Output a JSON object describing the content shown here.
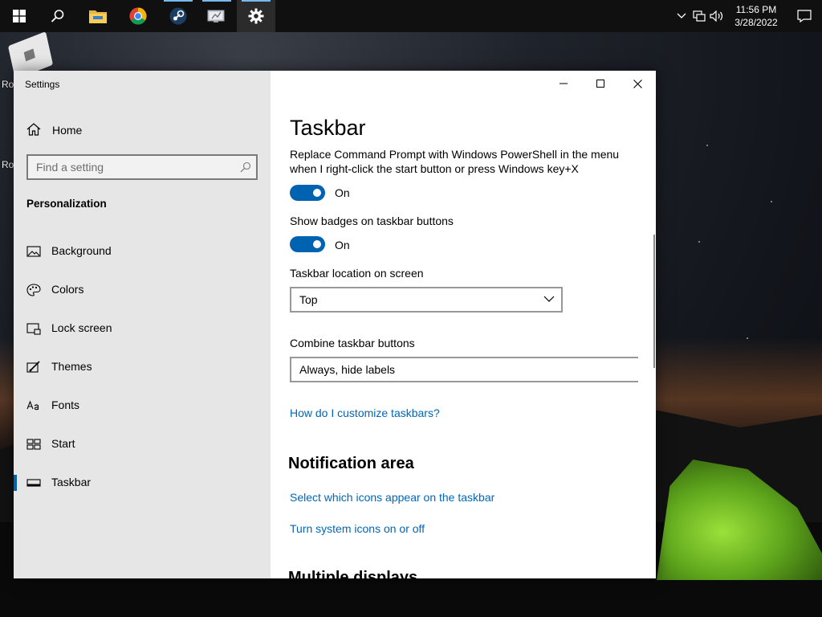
{
  "desktop": {
    "icon_label_1": "Ro",
    "icon_label_2": "Ro"
  },
  "taskbar": {
    "apps": [
      {
        "icon": "windows-start-icon"
      },
      {
        "icon": "search-icon"
      },
      {
        "icon": "file-explorer-icon"
      },
      {
        "icon": "chrome-icon"
      },
      {
        "icon": "steam-icon",
        "running": true
      },
      {
        "icon": "remote-desktop-icon",
        "running": true
      },
      {
        "icon": "settings-gear-icon",
        "running": true,
        "active": true
      }
    ],
    "clock": {
      "time": "11:56 PM",
      "date": "3/28/2022"
    }
  },
  "window": {
    "title": "Settings",
    "nav": {
      "home_label": "Home",
      "search_placeholder": "Find a setting",
      "section_title": "Personalization",
      "items": [
        {
          "label": "Background",
          "icon": "picture-icon"
        },
        {
          "label": "Colors",
          "icon": "palette-icon"
        },
        {
          "label": "Lock screen",
          "icon": "lock-screen-icon"
        },
        {
          "label": "Themes",
          "icon": "themes-brush-icon"
        },
        {
          "label": "Fonts",
          "icon": "fonts-icon"
        },
        {
          "label": "Start",
          "icon": "start-tiles-icon"
        },
        {
          "label": "Taskbar",
          "icon": "taskbar-icon",
          "selected": true
        }
      ]
    },
    "content": {
      "page_title": "Taskbar",
      "powershell_label": "Replace Command Prompt with Windows PowerShell in the menu when I right-click the start button or press Windows key+X",
      "powershell_state": "On",
      "badges_label": "Show badges on taskbar buttons",
      "badges_state": "On",
      "location_label": "Taskbar location on screen",
      "location_value": "Top",
      "combine_label": "Combine taskbar buttons",
      "combine_value": "Always, hide labels",
      "customize_link": "How do I customize taskbars?",
      "notification_heading": "Notification area",
      "select_icons_link": "Select which icons appear on the taskbar",
      "system_icons_link": "Turn system icons on or off",
      "multiple_displays_heading": "Multiple displays"
    },
    "colors": {
      "accent": "#0063b1",
      "link": "#0067b8",
      "nav_bg": "#e6e6e6"
    }
  }
}
